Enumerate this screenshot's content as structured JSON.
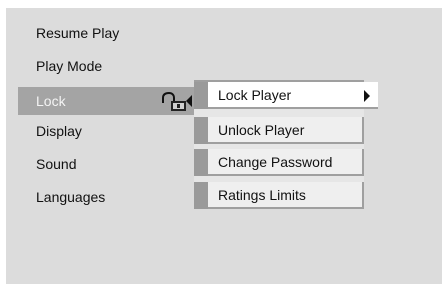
{
  "main_menu": {
    "items": [
      {
        "label": "Resume Play"
      },
      {
        "label": "Play Mode"
      },
      {
        "label": "Lock"
      },
      {
        "label": "Display"
      },
      {
        "label": "Sound"
      },
      {
        "label": "Languages"
      }
    ],
    "selected_index": 2
  },
  "submenu": {
    "items": [
      {
        "label": "Lock Player"
      },
      {
        "label": "Unlock Player"
      },
      {
        "label": "Change Password"
      },
      {
        "label": "Ratings Limits"
      }
    ],
    "selected_index": 0
  },
  "colors": {
    "background": "#dcdcdc",
    "selected_row": "#a4a4a4",
    "submenu_bar": "#9a9a9a",
    "submenu_item": "#efefef",
    "submenu_selected": "#ffffff"
  },
  "icons": {
    "lock_status": "padlock-open-icon",
    "submenu_open": "arrow-left-icon",
    "submenu_enter": "arrow-right-icon"
  }
}
